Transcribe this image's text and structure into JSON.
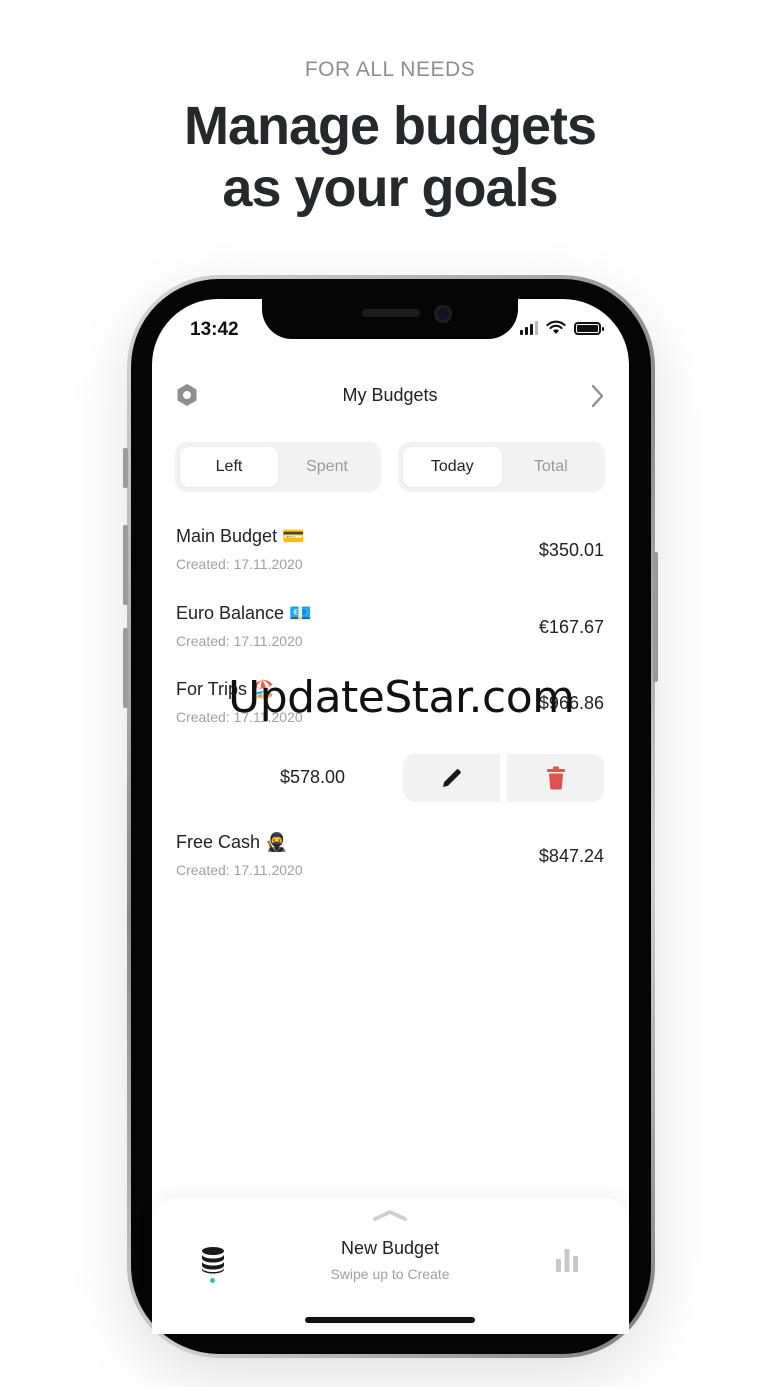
{
  "promo": {
    "eyebrow": "FOR ALL NEEDS",
    "headline_line1": "Manage budgets",
    "headline_line2": "as your goals"
  },
  "status_bar": {
    "time": "13:42",
    "icons": [
      "signal-icon",
      "wifi-icon",
      "battery-icon"
    ]
  },
  "header": {
    "title": "My Budgets",
    "left_icon": "settings-icon",
    "right_icon": "chevron-right-icon"
  },
  "segments": {
    "mode": {
      "options": [
        "Left",
        "Spent"
      ],
      "selected": "Left"
    },
    "period": {
      "options": [
        "Today",
        "Total"
      ],
      "selected": "Today"
    }
  },
  "budgets": [
    {
      "name": "Main Budget 💳",
      "created": "Created: 17.11.2020",
      "amount": "$350.01"
    },
    {
      "name": "Euro Balance 💶",
      "created": "Created: 17.11.2020",
      "amount": "€167.67"
    },
    {
      "name": "For Trips 🏖️",
      "created": "Created: 17.11.2020",
      "amount": "$966.86"
    },
    {
      "name": "Free Cash 🥷",
      "created": "Created: 17.11.2020",
      "amount": "$847.24"
    }
  ],
  "swiped_row": {
    "amount": "$578.00",
    "actions": [
      "edit-icon",
      "trash-icon"
    ],
    "delete_color": "#e05252"
  },
  "bottom_sheet": {
    "title": "New Budget",
    "hint": "Swipe up to Create",
    "left_icon": "database-icon",
    "right_icon": "bar-chart-icon",
    "active_dot_color": "#3bbf9e"
  },
  "watermark": "UpdateStar.com"
}
